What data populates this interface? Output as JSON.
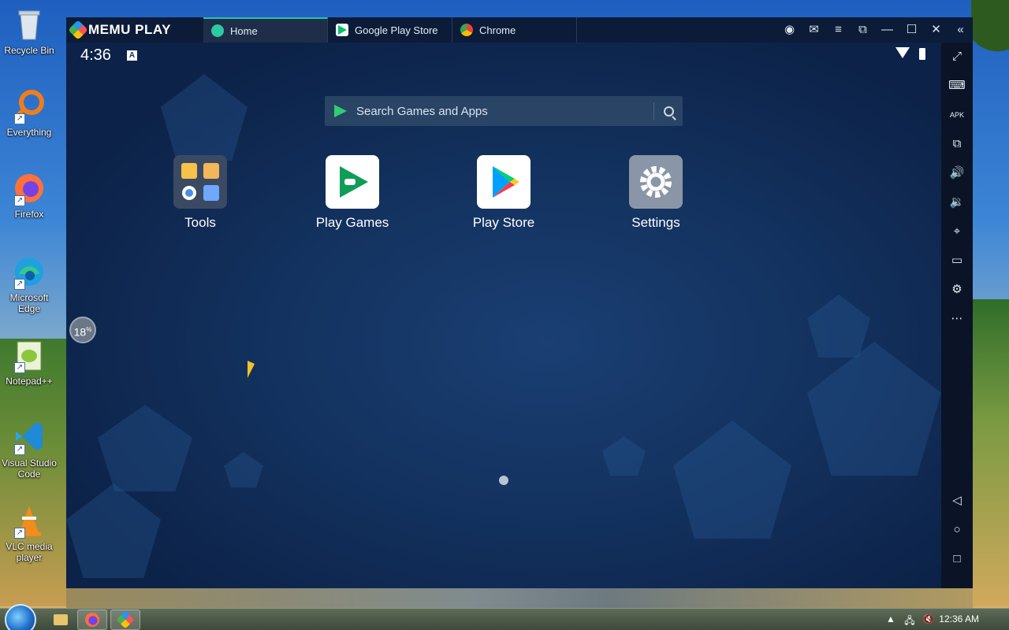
{
  "desktop": {
    "icons": [
      {
        "label": "Recycle Bin",
        "icon": "recycle-bin-icon"
      },
      {
        "label": "Everything",
        "icon": "everything-search-icon"
      },
      {
        "label": "Firefox",
        "icon": "firefox-icon"
      },
      {
        "label": "Microsoft Edge",
        "icon": "edge-icon"
      },
      {
        "label": "Notepad++",
        "icon": "notepadpp-icon"
      },
      {
        "label": "Visual Studio Code",
        "icon": "vscode-icon"
      },
      {
        "label": "VLC media player",
        "icon": "vlc-icon"
      }
    ]
  },
  "memu": {
    "brand": "MEMU PLAY",
    "tabs": [
      {
        "label": "Home",
        "icon": "home-tab-icon",
        "active": true
      },
      {
        "label": "Google Play Store",
        "icon": "play-store-tab-icon",
        "active": false
      },
      {
        "label": "Chrome",
        "icon": "chrome-tab-icon",
        "active": false
      }
    ],
    "window_controls": [
      "account-icon",
      "mail-icon",
      "menu-icon",
      "multi-window-icon",
      "minimize-icon",
      "maximize-icon",
      "close-icon",
      "collapse-sidebar-icon"
    ],
    "status_time": "4:36",
    "status_notif": "A",
    "search_placeholder": "Search Games and Apps",
    "apps": [
      {
        "label": "Tools",
        "icon": "tools-folder-icon"
      },
      {
        "label": "Play Games",
        "icon": "play-games-icon"
      },
      {
        "label": "Play Store",
        "icon": "play-store-icon"
      },
      {
        "label": "Settings",
        "icon": "settings-gear-icon"
      }
    ],
    "loader_percent": "18",
    "loader_percent_suffix": "%",
    "sidebar_tools": [
      "fullscreen-icon",
      "keyboard-icon",
      "apk-icon",
      "multi-instance-icon",
      "volume-up-icon",
      "volume-down-icon",
      "location-icon",
      "folder-icon",
      "settings-icon",
      "more-icon"
    ],
    "sidebar_apk_text": "APK",
    "nav": [
      "back-icon",
      "home-icon",
      "recents-icon"
    ],
    "colors": {
      "accent": "#27c2b0",
      "titlebar": "#0c1c38",
      "screen": "#13325f"
    }
  },
  "taskbar": {
    "clock": "12:36 AM"
  }
}
